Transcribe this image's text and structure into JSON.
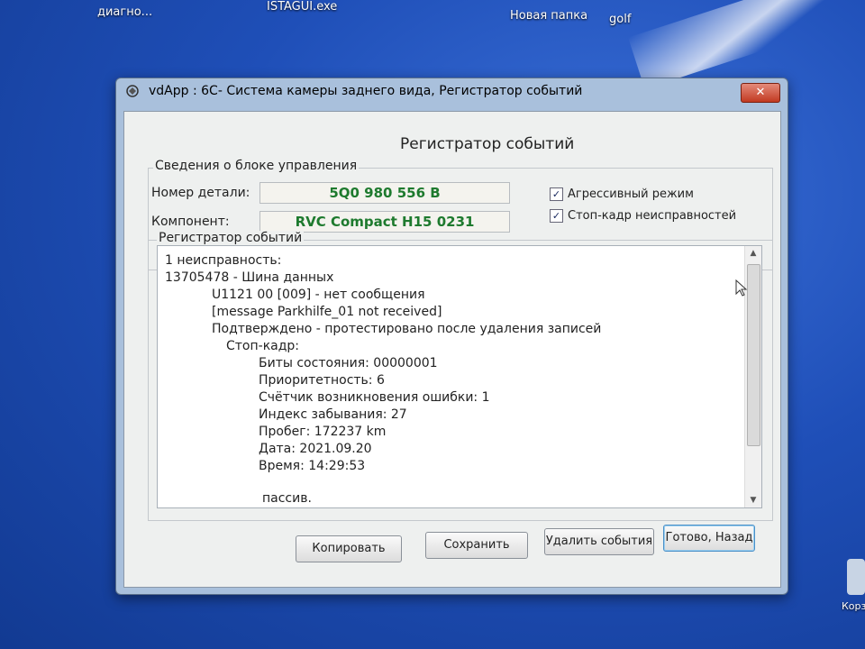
{
  "desktop": {
    "icon_labels": [
      "диагно...",
      "ISTAGUI.exe",
      "Новая папка",
      "golf",
      "Корзи"
    ]
  },
  "window": {
    "title": "vdApp : 6C- Система камеры заднего вида,  Регистратор событий",
    "close_label": "✕",
    "heading": "Регистратор событий"
  },
  "control_unit": {
    "group_label": "Сведения о блоке управления",
    "part_number_label": "Номер детали:",
    "part_number_value": "5Q0 980 556 B",
    "component_label": "Компонент:",
    "component_value": "RVC Compact    H15 0231"
  },
  "options": {
    "aggressive_mode": "Агрессивный режим",
    "freeze_frame": "Стоп-кадр неисправностей",
    "aggressive_checked": true,
    "freeze_checked": true
  },
  "event_log": {
    "group_label": "Регистратор событий",
    "lines": [
      "1 неисправность:",
      "13705478 - Шина данных",
      "U1121 00 [009] - нет сообщения",
      "[message Parkhilfe_01 not received]",
      "Подтверждено - протестировано после удаления записей",
      "Стоп-кадр:",
      "Биты состояния: 00000001",
      "Приоритетность: 6",
      "Счётчик возникновения ошибки: 1",
      "Индекс забывания: 27",
      "Пробег: 172237 km",
      "Дата: 2021.09.20",
      "Время: 14:29:53",
      "пассив."
    ]
  },
  "buttons": {
    "copy": "Копировать",
    "save": "Сохранить",
    "delete": "Удалить события",
    "done": "Готово, Назад"
  },
  "colors": {
    "value_text": "#1e7a2e",
    "desktop_blue": "#1f4fb8"
  }
}
